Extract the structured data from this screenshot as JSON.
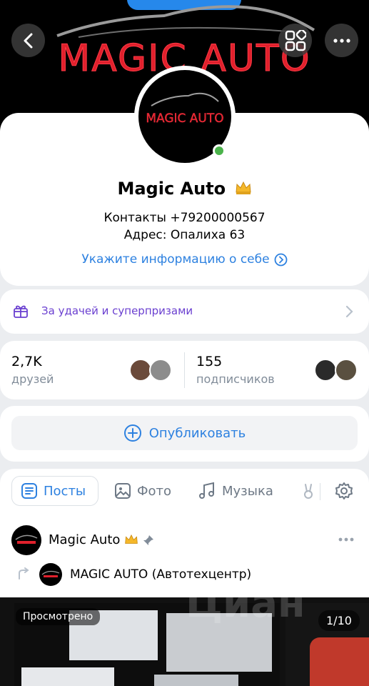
{
  "cover": {
    "brand_text": "MAGIC AUTO",
    "accent_color": "#e0202c"
  },
  "header": {
    "back_icon": "chevron-left-icon",
    "qr_icon": "qr-code-icon",
    "more_icon": "more-horizontal-icon"
  },
  "profile": {
    "avatar_text": "MAGIC AUTO",
    "name": "Magic Auto",
    "badge_icon": "crown-icon",
    "status_line_1": "Контакты +79200000567",
    "status_line_2": "Адрес: Опалиха 63",
    "about_link": "Укажите информацию о себе",
    "online": true
  },
  "gift_row": {
    "label": "За удачей и суперпризами"
  },
  "stats": {
    "friends_count": "2,7K",
    "friends_label": "друзей",
    "subscribers_count": "155",
    "subscribers_label": "подписчиков"
  },
  "publish": {
    "label": "Опубликовать"
  },
  "tabs": [
    {
      "label": "Посты",
      "active": true
    },
    {
      "label": "Фото",
      "active": false
    },
    {
      "label": "Музыка",
      "active": false
    }
  ],
  "post": {
    "author": "Magic Auto",
    "repost_source": "MAGIC AUTO (Автотехцентр)",
    "viewed_badge": "Просмотрено",
    "photo_counter": "1/10",
    "watermark": "Циан"
  },
  "colors": {
    "link_blue": "#2d81e0",
    "online_green": "#4bb34b",
    "gift_purple": "#6a3fd0"
  }
}
